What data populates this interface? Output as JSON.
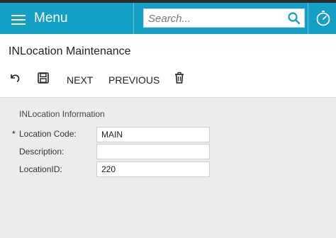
{
  "header": {
    "menu_label": "Menu",
    "search_placeholder": "Search...",
    "accent_color": "#149fc4"
  },
  "screen": {
    "title": "INLocation Maintenance"
  },
  "toolbar": {
    "undo_icon": "undo-icon",
    "save_icon": "save-icon",
    "next_label": "NEXT",
    "previous_label": "PREVIOUS",
    "delete_icon": "trash-icon"
  },
  "form": {
    "section_title": "INLocation Information",
    "required_marker": "*",
    "fields": [
      {
        "label": "Location Code:",
        "value": "MAIN",
        "required": true
      },
      {
        "label": "Description:",
        "value": "",
        "required": false
      },
      {
        "label": "LocationID:",
        "value": "220",
        "required": false
      }
    ]
  }
}
